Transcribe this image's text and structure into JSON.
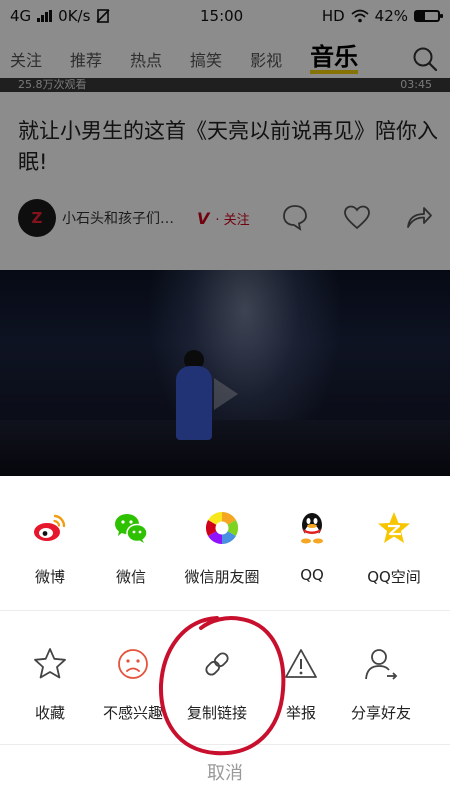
{
  "status_bar": {
    "network": "4G",
    "speed": "0K/s",
    "time": "15:00",
    "hd": "HD",
    "battery": "42%",
    "battery_level": 0.42
  },
  "top_nav": {
    "tabs": [
      "关注",
      "推荐",
      "热点",
      "搞笑",
      "影视",
      "音乐"
    ],
    "active_tab": "音乐"
  },
  "video_strip": {
    "left_text": "25.8万次观看",
    "right_text": "03:45"
  },
  "article": {
    "title": "就让小男生的这首《天亮以前说再见》陪你入眠!",
    "author": "小石头和孩子们…",
    "verified_badge": "V",
    "follow_label": "· 关注"
  },
  "share_sheet": {
    "row1": [
      {
        "label": "微博",
        "icon": "weibo-icon"
      },
      {
        "label": "微信",
        "icon": "wechat-icon"
      },
      {
        "label": "微信朋友圈",
        "icon": "moments-icon"
      },
      {
        "label": "QQ",
        "icon": "qq-icon"
      },
      {
        "label": "QQ空间",
        "icon": "qzone-icon"
      }
    ],
    "row2": [
      {
        "label": "收藏",
        "icon": "star-icon"
      },
      {
        "label": "不感兴趣",
        "icon": "sad-face-icon"
      },
      {
        "label": "复制链接",
        "icon": "link-icon"
      },
      {
        "label": "举报",
        "icon": "warning-icon"
      },
      {
        "label": "分享好友",
        "icon": "user-share-icon"
      }
    ],
    "cancel_label": "取消"
  },
  "colors": {
    "accent_yellow": "#f4d20a",
    "follow_red": "#d0021b",
    "annotation_red": "#c8102e"
  }
}
